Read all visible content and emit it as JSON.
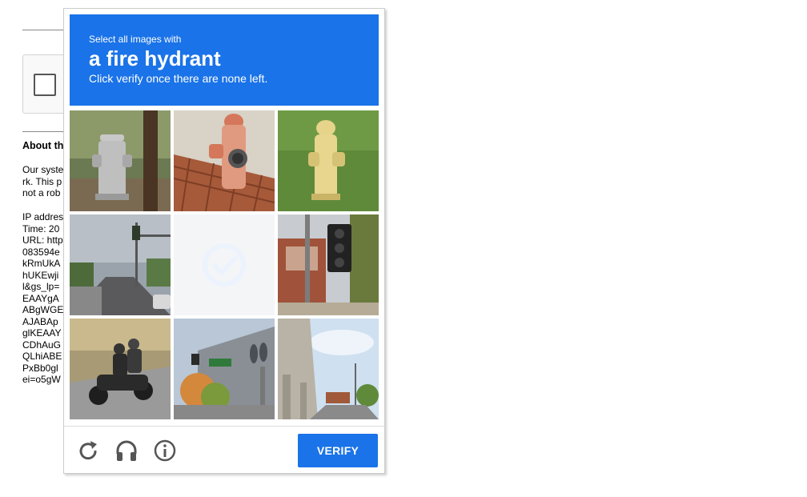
{
  "background": {
    "heading": "About th",
    "para_lines": [
      "Our syste",
      "rk. This p",
      "not a rob"
    ],
    "info_lines": [
      "IP addres",
      "Time: 20",
      "URL: http",
      "083594e",
      "kRmUkA",
      "hUKEwji",
      "l&gs_lp=",
      "EAAYgA",
      "ABgWGE",
      "AJABAp",
      "glKEAAY",
      "CDhAuG",
      "QLhiABE",
      "PxBb0gl",
      "ei=o5gW"
    ]
  },
  "captcha": {
    "instruction_small": "Select all images with",
    "target_object": "a fire hydrant",
    "instruction_hint": "Click verify once there are none left.",
    "tiles": [
      {
        "content": "silver fire hydrant next to pole",
        "selected": false
      },
      {
        "content": "orange fire hydrant on brick sidewalk",
        "selected": false
      },
      {
        "content": "yellow fire hydrant on grass",
        "selected": false
      },
      {
        "content": "street with traffic light",
        "selected": false
      },
      {
        "content": "fading tile (loading)",
        "selected": false
      },
      {
        "content": "traffic light on pole",
        "selected": false
      },
      {
        "content": "motorcycle riders on road",
        "selected": false
      },
      {
        "content": "street signs and building",
        "selected": false
      },
      {
        "content": "highway overpass",
        "selected": false
      }
    ],
    "verify_label": "VERIFY",
    "icons": [
      "reload-icon",
      "audio-headphones-icon",
      "info-icon"
    ],
    "accent_color": "#1a73e8"
  }
}
